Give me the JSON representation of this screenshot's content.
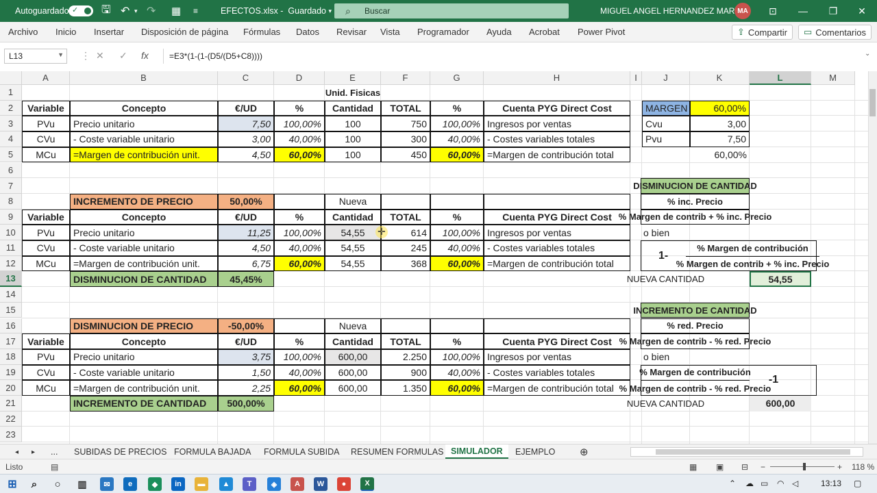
{
  "title_bar": {
    "autosave_label": "Autoguardado",
    "filename": "EFECTOS.xlsx",
    "status": "Guardado",
    "search_placeholder": "Buscar",
    "user_name": "MIGUEL ANGEL HERNANDEZ MARTIN",
    "user_initials": "MA"
  },
  "ribbon": {
    "tabs": [
      "Archivo",
      "Inicio",
      "Insertar",
      "Disposición de página",
      "Fórmulas",
      "Datos",
      "Revisar",
      "Vista",
      "Programador",
      "Ayuda",
      "Acrobat",
      "Power Pivot"
    ],
    "share_label": "Compartir",
    "comments_label": "Comentarios"
  },
  "formula_bar": {
    "name_box": "L13",
    "fx": "fx",
    "formula": "=E3*(1-(1-(D5/(D5+C8))))"
  },
  "grid": {
    "columns": [
      "A",
      "B",
      "C",
      "D",
      "E",
      "F",
      "G",
      "H",
      "I",
      "J",
      "K",
      "L",
      "M"
    ],
    "rows": [
      "1",
      "2",
      "3",
      "4",
      "5",
      "6",
      "7",
      "8",
      "9",
      "10",
      "11",
      "12",
      "13",
      "14",
      "15",
      "16",
      "17",
      "18",
      "19",
      "20",
      "21",
      "22",
      "23"
    ]
  },
  "cells": {
    "E1": "Unid. Fisicas",
    "A2": "Variable",
    "B2": "Concepto",
    "C2": "€/UD",
    "D2": "%",
    "E2": "Cantidad",
    "F2": "TOTAL",
    "G2": "%",
    "H2": "Cuenta PYG Direct Cost",
    "A3": "PVu",
    "B3": "Precio unitario",
    "C3": "7,50",
    "D3": "100,00%",
    "E3": "100",
    "F3": "750",
    "G3": "100,00%",
    "H3": "Ingresos por ventas",
    "A4": "CVu",
    "B4": "- Coste variable unitario",
    "C4": "3,00",
    "D4": "40,00%",
    "E4": "100",
    "F4": "300",
    "G4": "40,00%",
    "H4": "- Costes variables totales",
    "A5": "MCu",
    "B5": "=Margen de contribución unit.",
    "C5": "4,50",
    "D5": "60,00%",
    "E5": "100",
    "F5": "450",
    "G5": "60,00%",
    "H5": "=Margen de contribución total",
    "B8": "INCREMENTO DE PRECIO",
    "C8": "50,00%",
    "E8": "Nueva",
    "A9": "Variable",
    "B9": "Concepto",
    "C9": "€/UD",
    "D9": "%",
    "E9": "Cantidad",
    "F9": "TOTAL",
    "G9": "%",
    "H9": "Cuenta PYG Direct Cost",
    "A10": "PVu",
    "B10": "Precio unitario",
    "C10": "11,25",
    "D10": "100,00%",
    "E10": "54,55",
    "F10": "614",
    "G10": "100,00%",
    "H10": "Ingresos por ventas",
    "A11": "CVu",
    "B11": "- Coste variable unitario",
    "C11": "4,50",
    "D11": "40,00%",
    "E11": "54,55",
    "F11": "245",
    "G11": "40,00%",
    "H11": "- Costes variables totales",
    "A12": "MCu",
    "B12": "=Margen de contribución unit.",
    "C12": "6,75",
    "D12": "60,00%",
    "E12": "54,55",
    "F12": "368",
    "G12": "60,00%",
    "H12": "=Margen de contribución total",
    "B13": "DISMINUCION DE CANTIDAD",
    "C13": "45,45%",
    "B16": "DISMINUCION DE PRECIO",
    "C16": "-50,00%",
    "E16": "Nueva",
    "A17": "Variable",
    "B17": "Concepto",
    "C17": "€/UD",
    "D17": "%",
    "E17": "Cantidad",
    "F17": "TOTAL",
    "G17": "%",
    "H17": "Cuenta PYG Direct Cost",
    "A18": "PVu",
    "B18": "Precio unitario",
    "C18": "3,75",
    "D18": "100,00%",
    "E18": "600,00",
    "F18": "2.250",
    "G18": "100,00%",
    "H18": "Ingresos por ventas",
    "A19": "CVu",
    "B19": "- Coste variable unitario",
    "C19": "1,50",
    "D19": "40,00%",
    "E19": "600,00",
    "F19": "900",
    "G19": "40,00%",
    "H19": "- Costes variables totales",
    "A20": "MCu",
    "B20": "=Margen de contribución unit.",
    "C20": "2,25",
    "D20": "60,00%",
    "E20": "600,00",
    "F20": "1.350",
    "G20": "60,00%",
    "H20": "=Margen de contribución total",
    "B21": "INCREMENTO  DE CANTIDAD",
    "C21": "500,00%",
    "J2": "MARGEN",
    "K2": "60,00%",
    "J3": "Cvu",
    "K3": "3,00",
    "J4": "Pvu",
    "K4": "7,50",
    "K5": "60,00%"
  },
  "side_panel": {
    "dec_title": "DISMINUCION DE CANTIDAD",
    "dec_numerator": "% inc. Precio",
    "dec_denominator": "% Margen de contrib  + % inc. Precio",
    "dec_or": "o bien",
    "dec_one": "1-",
    "dec_alt_numerator": "% Margen de contribución",
    "dec_alt_denominator": "% Margen de contrib  + % inc. Precio",
    "dec_result_label": "NUEVA CANTIDAD",
    "dec_result_value": "54,55",
    "inc_title": "INCREMENTO DE CANTIDAD",
    "inc_numerator": "% red. Precio",
    "inc_denominator": "% Margen de contrib  - % red. Precio",
    "inc_or": "o bien",
    "inc_alt_numerator": "% Margen de contribución",
    "inc_alt_denominator": "% Margen de contrib  - % red. Precio",
    "inc_minus_one": "-1",
    "inc_result_label": "NUEVA CANTIDAD",
    "inc_result_value": "600,00"
  },
  "sheet_tabs": {
    "ellipsis": "...",
    "tabs": [
      "SUBIDAS DE PRECIOS",
      "FORMULA BAJADA",
      "FORMULA SUBIDA",
      "RESUMEN FORMULAS",
      "SIMULADOR",
      "EJEMPLO"
    ],
    "active": "SIMULADOR",
    "add": "⊕"
  },
  "status_bar": {
    "ready": "Listo",
    "zoom": "118 %",
    "zoom_level": 1.18
  },
  "taskbar": {
    "time": "13:13"
  },
  "colors": {
    "excel_green": "#217346",
    "yellow": "#ffff00",
    "orange": "#f4b083",
    "green": "#a9d08e",
    "blue": "#8eb4e3"
  }
}
